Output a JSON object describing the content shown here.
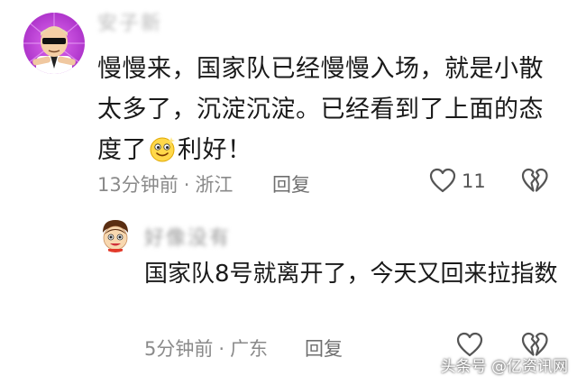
{
  "comment": {
    "username": "安子新",
    "text_before_emoji": "慢慢来，国家队已经慢慢入场，就是小散太多了，沉淀沉淀。已经看到了上面的态度了",
    "emoji_icon": "smile-emoji-icon",
    "text_after_emoji": "利好！",
    "time": "13分钟前",
    "separator": "·",
    "location": "浙江",
    "reply_label": "回复",
    "like_count": "11"
  },
  "reply": {
    "username": "好像没有",
    "text": "国家队8号就离开了，今天又回来拉指数",
    "time": "5分钟前",
    "separator": "·",
    "location": "广东",
    "reply_label": "回复"
  },
  "watermark": "头条号 @亿资讯网",
  "colors": {
    "avatar_bg": "#c23bd8",
    "meta_text": "#8a8a8a",
    "icon_stroke": "#555555"
  }
}
